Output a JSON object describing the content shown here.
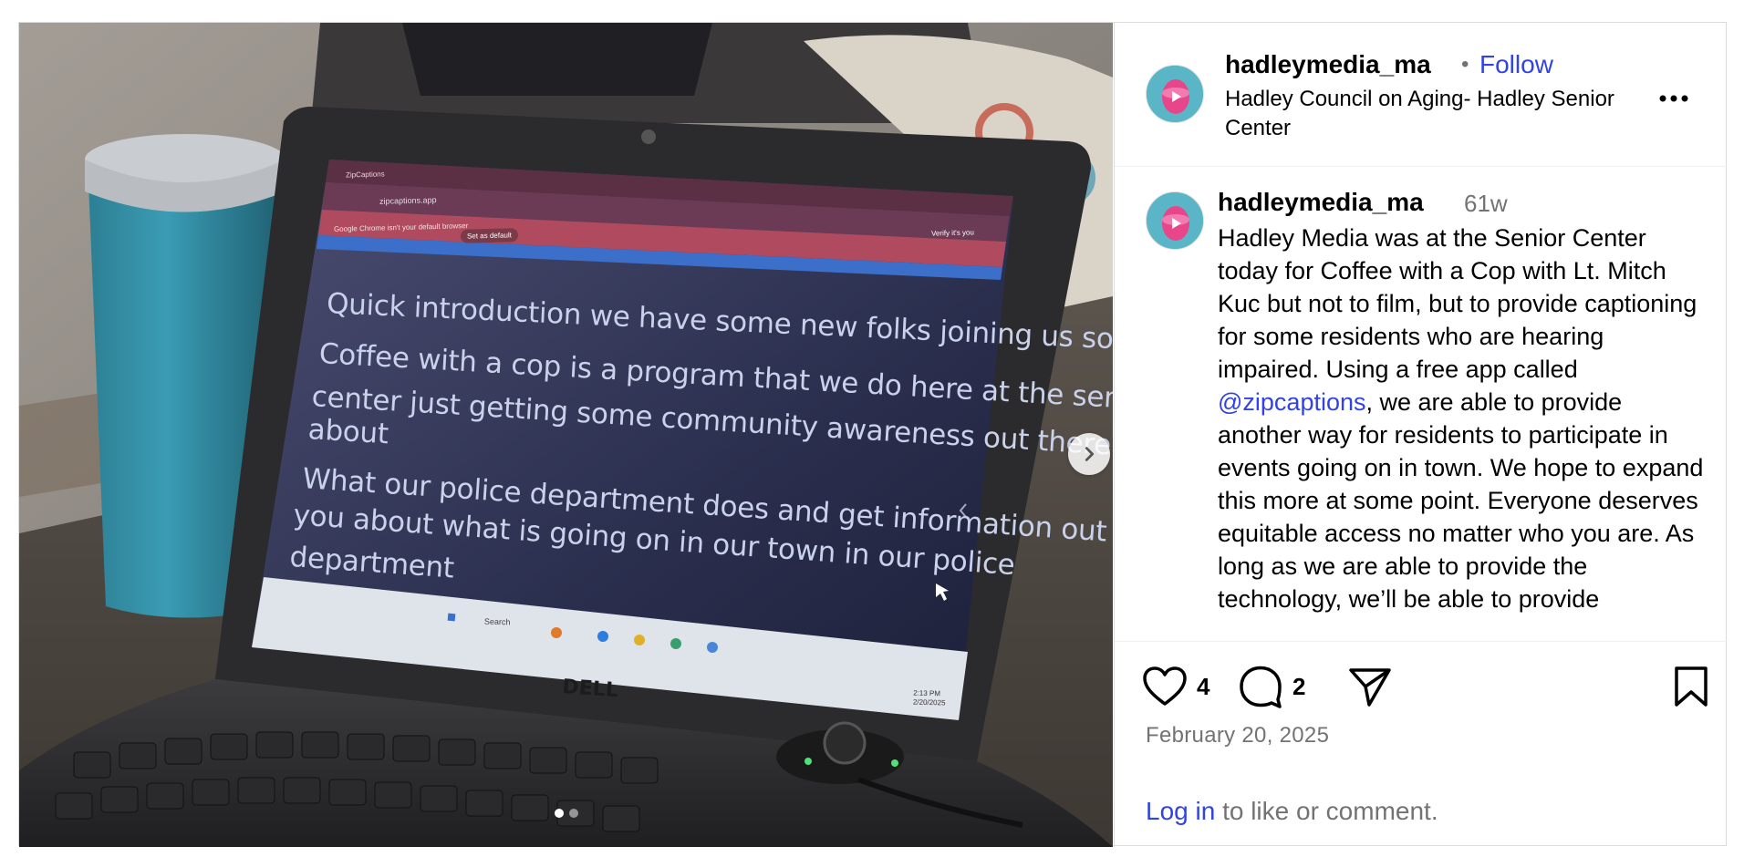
{
  "post": {
    "username": "hadleymedia_ma",
    "separator": "•",
    "follow_label": "Follow",
    "location": "Hadley Council on Aging- Hadley Senior Center",
    "caption_username": "hadleymedia_ma",
    "caption_time": "61w",
    "caption_before": "Hadley Media was at the Senior Center today for Coffee with a Cop with Lt. Mitch Kuc but not to film, but to provide captioning for some residents who are hearing impaired. Using a free app called ",
    "caption_mention": "@zipcaptions",
    "caption_after": ", we are able to provide another way for residents to participate in events going on in town. We hope to expand this more at some point. Everyone deserves equitable access no matter who you are. As long as we are able to provide the technology, we’ll be able to provide",
    "likes": "4",
    "comments": "2",
    "date": "February 20, 2025",
    "login_link": "Log in",
    "login_rest": " to like or comment."
  },
  "photo": {
    "chrome_tab": "ZipCaptions",
    "chrome_url": "zipcaptions.app",
    "chrome_notice": "Google Chrome isn't your default browser",
    "chrome_set_default": "Set as default",
    "chrome_verify": "Verify it's you",
    "captions": [
      "Quick introduction we have some new folks joining us so",
      "Coffee with a cop is a program that we do here at the senior",
      "center just getting some community awareness out there",
      "about",
      "What our police department does and get information out to",
      "you about what is going on in our town in our police",
      "department"
    ],
    "taskbar_search": "Search",
    "taskbar_time": "2:13 PM",
    "taskbar_date": "2/20/2025",
    "laptop_brand": "DELL",
    "slide_count": 2,
    "active_slide": 1
  },
  "icons": {
    "more": "more-horizontal-icon",
    "next": "chevron-right-icon",
    "like": "heart-icon",
    "comment": "comment-bubble-icon",
    "share": "paper-plane-icon",
    "save": "bookmark-icon"
  },
  "colors": {
    "link": "#3143e6",
    "muted": "#737373",
    "border": "#dbdbdb"
  }
}
